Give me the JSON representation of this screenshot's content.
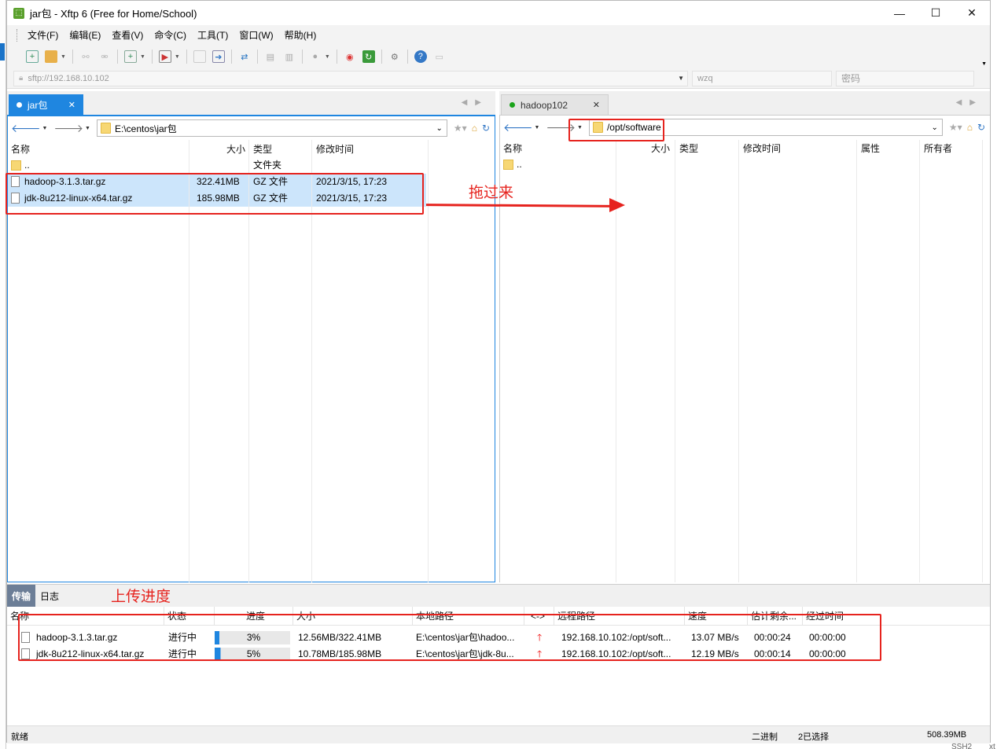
{
  "window": {
    "title": "jar包 - Xftp 6 (Free for Home/School)",
    "minimize": "—",
    "maximize": "☐",
    "close": "✕"
  },
  "menu": [
    "文件(F)",
    "编辑(E)",
    "查看(V)",
    "命令(C)",
    "工具(T)",
    "窗口(W)",
    "帮助(H)"
  ],
  "address": {
    "host": "sftp://192.168.10.102",
    "user": "wzq",
    "password_placeholder": "密码"
  },
  "left_pane": {
    "tab_label": "jar包",
    "path": "E:\\centos\\jar包",
    "columns": [
      "名称",
      "大小",
      "类型",
      "修改时间"
    ],
    "parent_row": {
      "name": "..",
      "type": "文件夹"
    },
    "files": [
      {
        "name": "hadoop-3.1.3.tar.gz",
        "size": "322.41MB",
        "type": "GZ 文件",
        "modified": "2021/3/15, 17:23"
      },
      {
        "name": "jdk-8u212-linux-x64.tar.gz",
        "size": "185.98MB",
        "type": "GZ 文件",
        "modified": "2021/3/15, 17:23"
      }
    ]
  },
  "right_pane": {
    "tab_label": "hadoop102",
    "path": "/opt/software",
    "columns": [
      "名称",
      "大小",
      "类型",
      "修改时间",
      "属性",
      "所有者"
    ],
    "parent_row": {
      "name": ".."
    }
  },
  "annotations": {
    "drag": "拖过来",
    "upload": "上传进度"
  },
  "transfer": {
    "tabs": [
      "传输",
      "日志"
    ],
    "columns": [
      "名称",
      "状态",
      "进度",
      "大小",
      "本地路径",
      "<->",
      "远程路径",
      "速度",
      "估计剩余...",
      "经过时间"
    ],
    "rows": [
      {
        "name": "hadoop-3.1.3.tar.gz",
        "status": "进行中",
        "progress": "3%",
        "progress_value": 3,
        "size": "12.56MB/322.41MB",
        "local": "E:\\centos\\jar包\\hadoo...",
        "remote": "192.168.10.102:/opt/soft...",
        "speed": "13.07 MB/s",
        "remaining": "00:00:24",
        "elapsed": "00:00:00"
      },
      {
        "name": "jdk-8u212-linux-x64.tar.gz",
        "status": "进行中",
        "progress": "5%",
        "progress_value": 5,
        "size": "10.78MB/185.98MB",
        "local": "E:\\centos\\jar包\\jdk-8u...",
        "remote": "192.168.10.102:/opt/soft...",
        "speed": "12.19 MB/s",
        "remaining": "00:00:14",
        "elapsed": "00:00:00"
      }
    ]
  },
  "status": {
    "left": "就绪",
    "mode": "二进制",
    "selection": "2已选择",
    "size": "508.39MB"
  },
  "below_window": {
    "ssh": "SSH2",
    "xt": "xt"
  },
  "colors": {
    "accent": "#1f86e0",
    "selection": "#cce5fb",
    "annotation": "#e6231e"
  }
}
